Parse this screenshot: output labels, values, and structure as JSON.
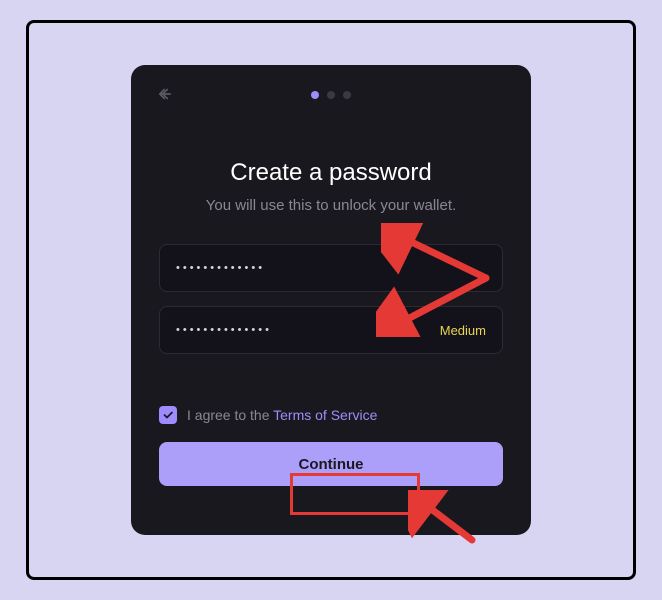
{
  "header": {
    "progress_dots": 3,
    "active_dot": 0
  },
  "title": "Create a password",
  "subtitle": "You will use this to unlock your wallet.",
  "password_field": {
    "masked_value": "•••••••••••••"
  },
  "confirm_field": {
    "masked_value": "••••••••••••••",
    "strength_label": "Medium",
    "strength_color": "#e8d455"
  },
  "terms": {
    "checked": true,
    "prefix": "I agree to the ",
    "link_text": "Terms of Service"
  },
  "continue_button": {
    "label": "Continue"
  },
  "annotations": {
    "continue_highlighted": true,
    "arrows_pointing_to_inputs": true
  }
}
